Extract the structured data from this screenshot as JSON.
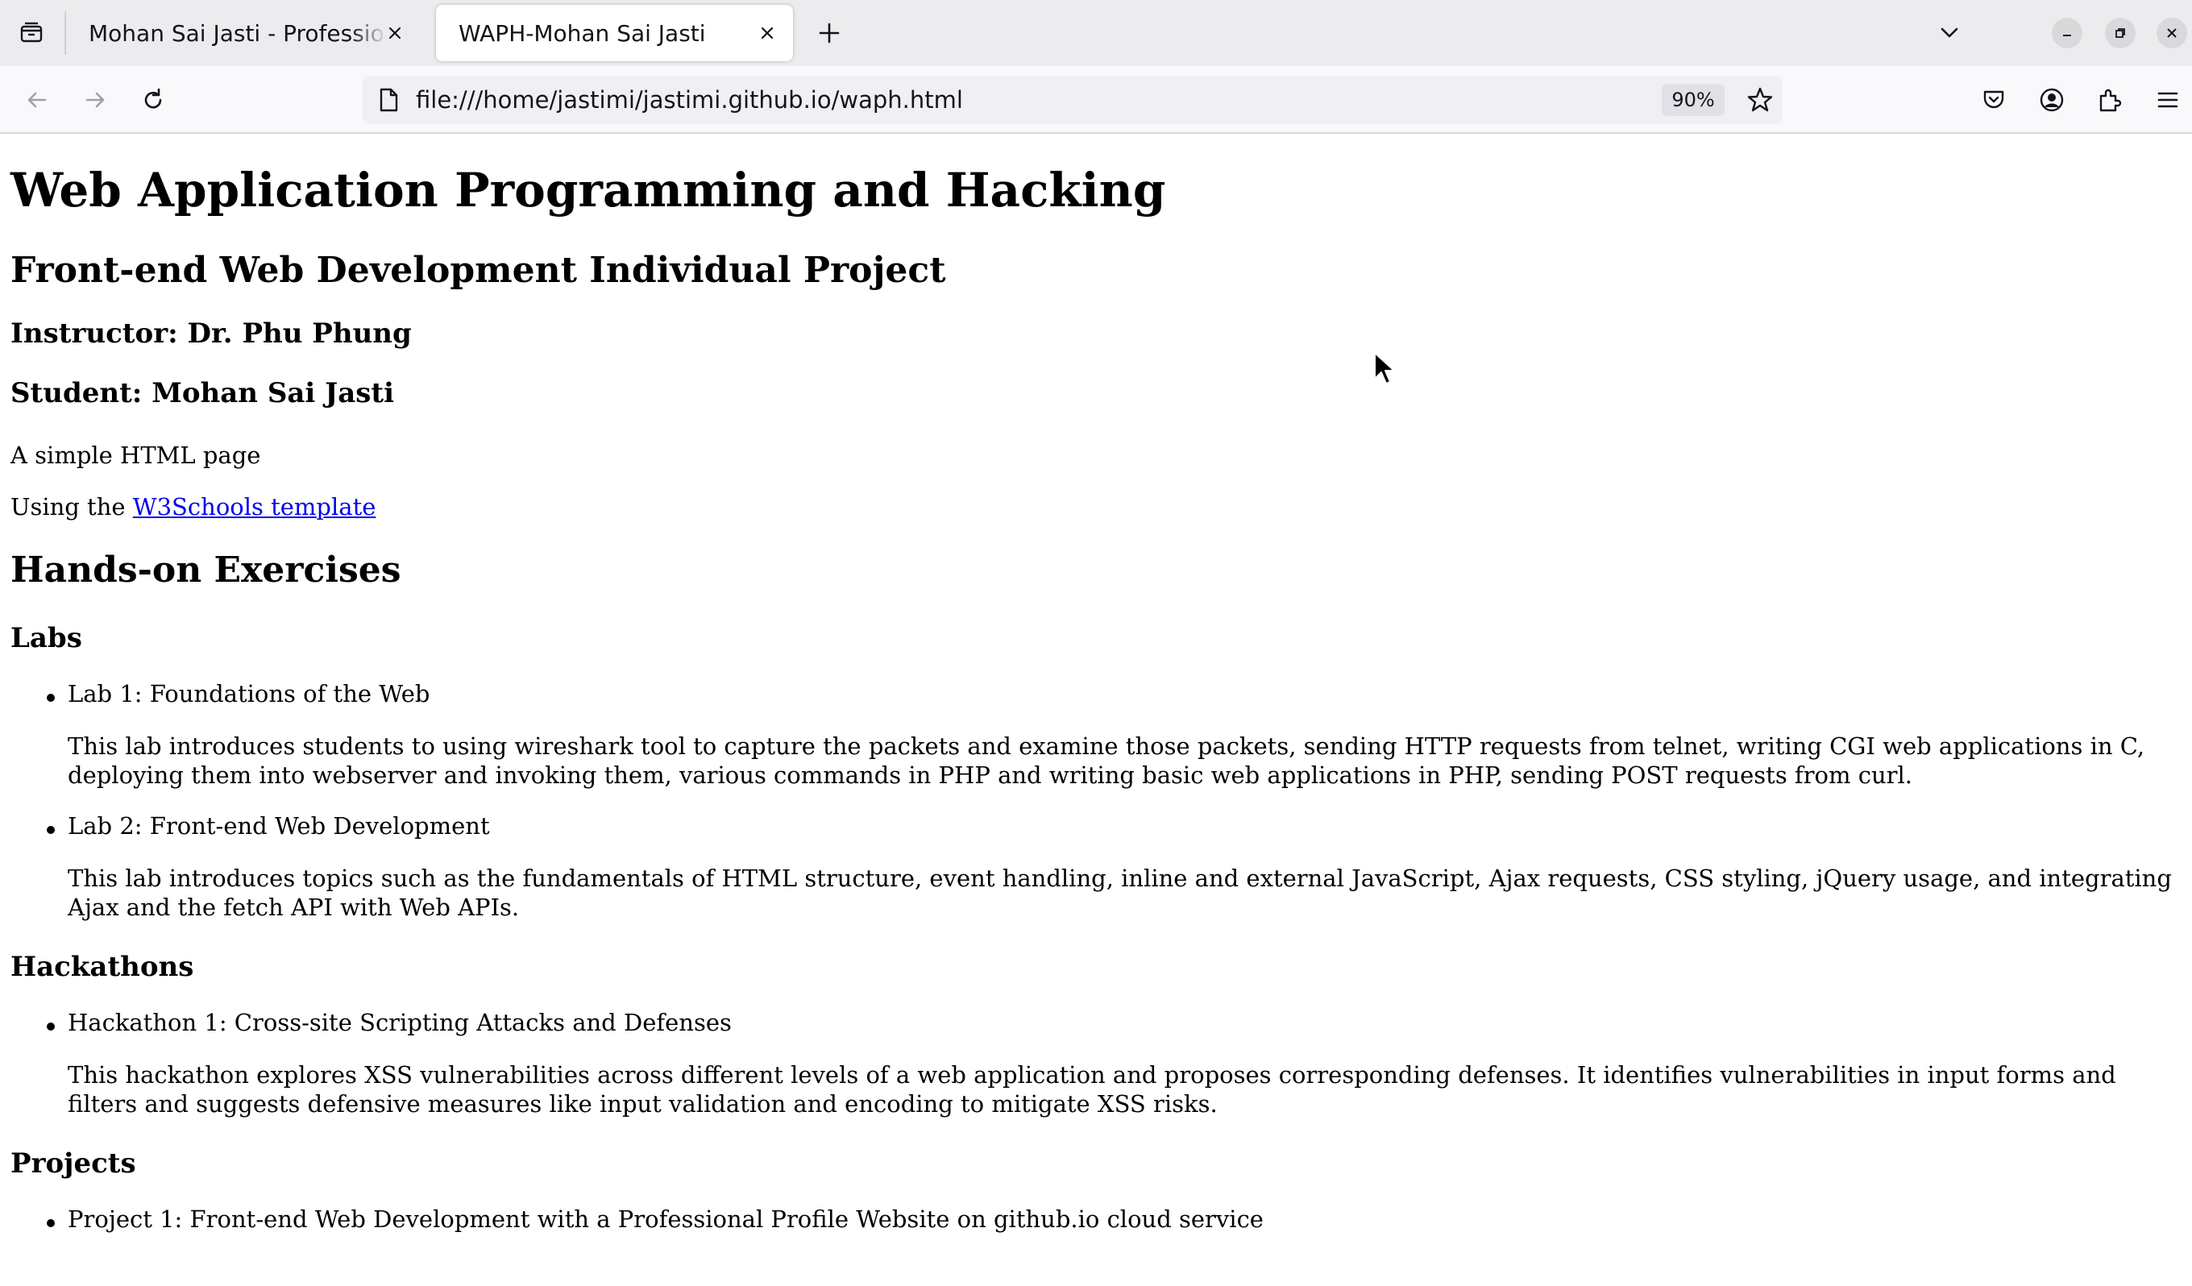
{
  "browser": {
    "tabs": [
      {
        "title": "Mohan Sai Jasti - Professional Profile",
        "active": false
      },
      {
        "title": "WAPH-Mohan Sai Jasti",
        "active": true
      }
    ],
    "url": "file:///home/jastimi/jastimi.github.io/waph.html",
    "zoom": "90%",
    "icons": {
      "tab_list": "tab-list-icon",
      "new_tab": "plus-icon",
      "back": "arrow-left-icon",
      "forward": "arrow-right-icon",
      "reload": "reload-icon",
      "page": "page-icon",
      "bookmark": "star-icon",
      "pocket": "pocket-icon",
      "account": "account-icon",
      "extensions": "puzzle-icon",
      "menu": "hamburger-menu-icon"
    }
  },
  "page": {
    "title": "Web Application Programming and Hacking",
    "subtitle": "Front-end Web Development Individual Project",
    "instructor": "Instructor: Dr. Phu Phung",
    "student": "Student: Mohan Sai Jasti",
    "intro": "A simple HTML page",
    "template_prefix": "Using the ",
    "template_link": "W3Schools template",
    "hands_on_heading": "Hands-on Exercises",
    "labs_heading": "Labs",
    "labs": [
      {
        "title": "Lab 1: Foundations of the Web",
        "description": "This lab introduces students to using wireshark tool to capture the packets and examine those packets, sending HTTP requests from telnet, writing CGI web applications in C, deploying them into webserver and invoking them, various commands in PHP and writing basic web applications in PHP, sending POST requests from curl."
      },
      {
        "title": "Lab 2: Front-end Web Development",
        "description": "This lab introduces topics such as the fundamentals of HTML structure, event handling, inline and external JavaScript, Ajax requests, CSS styling, jQuery usage, and integrating Ajax and the fetch API with Web APIs."
      }
    ],
    "hackathons_heading": "Hackathons",
    "hackathons": [
      {
        "title": "Hackathon 1: Cross-site Scripting Attacks and Defenses",
        "description": "This hackathon explores XSS vulnerabilities across different levels of a web application and proposes corresponding defenses. It identifies vulnerabilities in input forms and filters and suggests defensive measures like input validation and encoding to mitigate XSS risks."
      }
    ],
    "projects_heading": "Projects",
    "projects": [
      {
        "title": "Project 1: Front-end Web Development with a Professional Profile Website on github.io cloud service"
      }
    ]
  }
}
